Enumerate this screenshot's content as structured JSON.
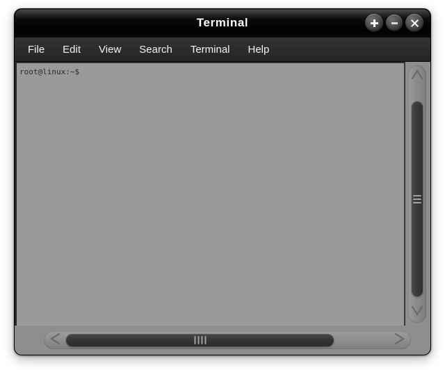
{
  "window": {
    "title": "Terminal",
    "buttons": [
      {
        "name": "maximize-button",
        "icon": "plus-icon",
        "label": "+"
      },
      {
        "name": "minimize-button",
        "icon": "minus-icon",
        "label": "−"
      },
      {
        "name": "close-button",
        "icon": "close-icon",
        "label": "✕"
      }
    ]
  },
  "menubar": {
    "items": [
      {
        "label": "File"
      },
      {
        "label": "Edit"
      },
      {
        "label": "View"
      },
      {
        "label": "Search"
      },
      {
        "label": "Terminal"
      },
      {
        "label": "Help"
      }
    ]
  },
  "terminal": {
    "prompt": "root@linux:~$",
    "lines": [
      "root@linux:~$"
    ],
    "background_color": "#9a9a9a",
    "text_color": "#2b2b2b"
  },
  "scrollbars": {
    "vertical": {
      "up_arrow_icon": "chevron-up-icon",
      "down_arrow_icon": "chevron-down-icon",
      "thumb_grip_lines": 3
    },
    "horizontal": {
      "left_arrow_icon": "chevron-left-icon",
      "right_arrow_icon": "chevron-right-icon",
      "thumb_grip_lines": 4
    }
  },
  "colors": {
    "titlebar": "#050505",
    "menubar": "#2c2c2c",
    "window_chrome": "#8e8e8e",
    "terminal_bg": "#9a9a9a",
    "page_bg": "#ffffff"
  }
}
